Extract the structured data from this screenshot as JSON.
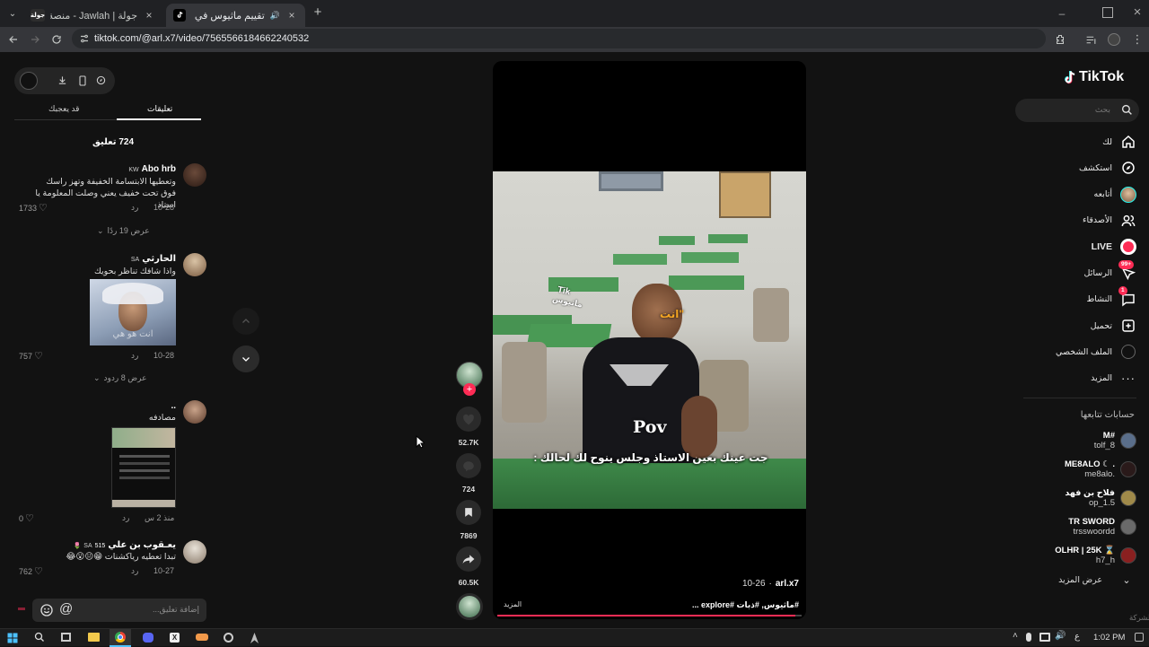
{
  "browser": {
    "tabs": [
      {
        "title": "جولة | Jawlah - منصة الألعاب الا...",
        "favicon": "جولة"
      },
      {
        "title": "تقييم ماثيوس في المسلسل ...",
        "favicon": "tiktok"
      }
    ],
    "new_tab_label": "+",
    "url": "tiktok.com/@arl.x7/video/7565566184662240532"
  },
  "comments_panel": {
    "tab_comments": "تعليقات",
    "tab_liked": "قد يعجبك",
    "count_label": "724 تعليق",
    "input_placeholder": "إضافة تعليق...",
    "comments": [
      {
        "author": "Abo hrb",
        "flag": "KW",
        "text": "وتعطيها الابتسامة الخفيفة وتهز راسك فوق تحت خفيف يعني وصلت المعلومة يا استاذ",
        "date": "10-28",
        "reply": "رد",
        "likes": "1733",
        "view_replies": "عرض 19 ردًا"
      },
      {
        "author": "الحارثي",
        "flag": "SA",
        "text": "واذا شافك تناظر بحويك",
        "image_caption": "انت هو هي",
        "date": "10-28",
        "reply": "رد",
        "likes": "757",
        "view_replies": "عرض 8 ردود"
      },
      {
        "author": "..",
        "text": "مصادفه",
        "date": "منذ 2 س",
        "reply": "رد",
        "likes": "0"
      },
      {
        "author": "يعـقوب بن علي",
        "flag": "SA",
        "superscript": "515",
        "text": "تبدا تعطيه رياكشنات 😁😐😮😂",
        "date": "10-27",
        "reply": "رد",
        "likes": "762"
      }
    ]
  },
  "video": {
    "overlay_tik": "Tik",
    "overlay_matheus": "ماثيوس",
    "overlay_anta": "انت\"",
    "overlay_pov": "Pov",
    "caption": "جت عينك بعين الاستاذ وجلس ينوح لك لحالك :",
    "author_handle": "arl.x7",
    "date": "10-26",
    "hashtags": "#ماثيوس, #ذبات #explore ...",
    "more_label": "المزيد",
    "progress": 0.98
  },
  "actions": {
    "likes": "52.7K",
    "comments": "724",
    "saves": "7869",
    "shares": "60.5K"
  },
  "nav": {
    "logo": "TikTok",
    "search_placeholder": "بحث",
    "items": [
      {
        "label": "لك",
        "icon": "home-icon"
      },
      {
        "label": "استكشف",
        "icon": "compass-icon"
      },
      {
        "label": "أتابعه",
        "icon": "following-avatar-icon"
      },
      {
        "label": "الأصدقاء",
        "icon": "friends-icon"
      },
      {
        "label": "LIVE",
        "icon": "live-icon"
      },
      {
        "label": "الرسائل",
        "icon": "messages-icon",
        "badge": "99+"
      },
      {
        "label": "النشاط",
        "icon": "activity-icon",
        "badge": "1"
      },
      {
        "label": "تحميل",
        "icon": "upload-icon"
      },
      {
        "label": "الملف الشخصي",
        "icon": "profile-icon"
      },
      {
        "label": "المزيد",
        "icon": "more-icon"
      }
    ],
    "following_title": "حسابات تتابعها",
    "following": [
      {
        "name": "M#",
        "handle": "tolf_8"
      },
      {
        "name": "ME8ALO ☾ .",
        "handle": "me8alo."
      },
      {
        "name": "فلاح بن فهد",
        "handle": "op_1.5"
      },
      {
        "name": "TR SWORD",
        "handle": "trsswoordd"
      },
      {
        "name": "OLHR | 25K ⌛",
        "handle": "h7_h"
      }
    ],
    "show_more": "عرض المزيد",
    "company_label": "الشركة"
  },
  "taskbar": {
    "lang": "ع",
    "time": "1:02 PM"
  }
}
